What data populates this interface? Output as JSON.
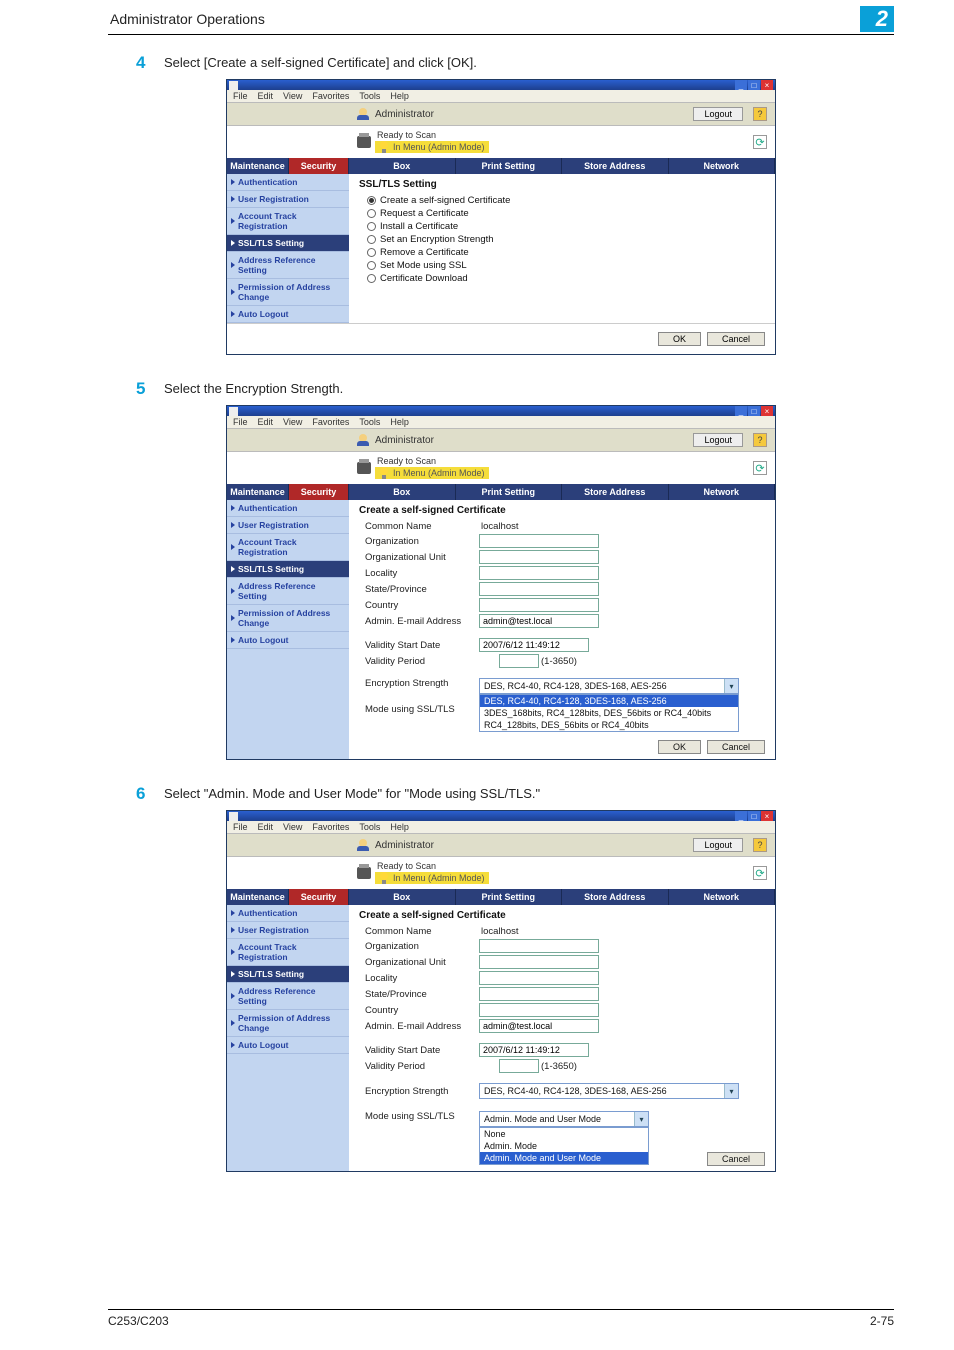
{
  "header": {
    "title": "Administrator Operations",
    "badge": "2"
  },
  "steps": {
    "s4": {
      "num": "4",
      "text": "Select [Create a self-signed Certificate] and click [OK]."
    },
    "s5": {
      "num": "5",
      "text": "Select the Encryption Strength."
    },
    "s6": {
      "num": "6",
      "text": "Select \"Admin. Mode and User Mode\" for \"Mode using SSL/TLS.\""
    }
  },
  "browser": {
    "menus": {
      "file": "File",
      "edit": "Edit",
      "view": "View",
      "favorites": "Favorites",
      "tools": "Tools",
      "help": "Help"
    },
    "admin_label": "Administrator",
    "logout": "Logout",
    "help": "?",
    "ready": "Ready to Scan",
    "inmenu": "In Menu (Admin Mode)",
    "tabs": {
      "maintenance": "Maintenance",
      "security": "Security",
      "box": "Box",
      "print": "Print Setting",
      "store": "Store Address",
      "network": "Network"
    }
  },
  "sidebar": {
    "auth": "Authentication",
    "user_reg": "User Registration",
    "acct_track": "Account Track Registration",
    "ssl": "SSL/TLS Setting",
    "addr_ref": "Address Reference Setting",
    "perm_addr": "Permission of Address Change",
    "auto_logout": "Auto Logout"
  },
  "shot1": {
    "title": "SSL/TLS Setting",
    "opts": {
      "create": "Create a self-signed Certificate",
      "request": "Request a Certificate",
      "install": "Install a Certificate",
      "enc": "Set an Encryption Strength",
      "remove": "Remove a Certificate",
      "mode": "Set Mode using SSL",
      "download": "Certificate Download"
    }
  },
  "shot2": {
    "title": "Create a self-signed Certificate",
    "labels": {
      "cn": "Common Name",
      "cn_val": "localhost",
      "org": "Organization",
      "ou": "Organizational Unit",
      "loc": "Locality",
      "state": "State/Province",
      "country": "Country",
      "email": "Admin. E-mail Address",
      "email_val": "admin@test.local",
      "start": "Validity Start Date",
      "start_val": "2007/6/12 11:49:12",
      "period": "Validity Period",
      "period_hint": "(1-3650)",
      "enc": "Encryption Strength",
      "mode": "Mode using SSL/TLS"
    },
    "enc_sel": "DES, RC4-40, RC4-128, 3DES-168, AES-256",
    "enc_opts": {
      "o1": "DES, RC4-40, RC4-128, 3DES-168, AES-256",
      "o2": "3DES_168bits, RC4_128bits, DES_56bits or RC4_40bits",
      "o3": "RC4_128bits, DES_56bits or RC4_40bits"
    }
  },
  "shot3": {
    "mode_sel": "Admin. Mode and User Mode",
    "mode_opts": {
      "none": "None",
      "admin": "Admin. Mode",
      "both": "Admin. Mode and User Mode"
    }
  },
  "buttons": {
    "ok": "OK",
    "cancel": "Cancel"
  },
  "footer": {
    "left": "C253/C203",
    "right": "2-75"
  }
}
